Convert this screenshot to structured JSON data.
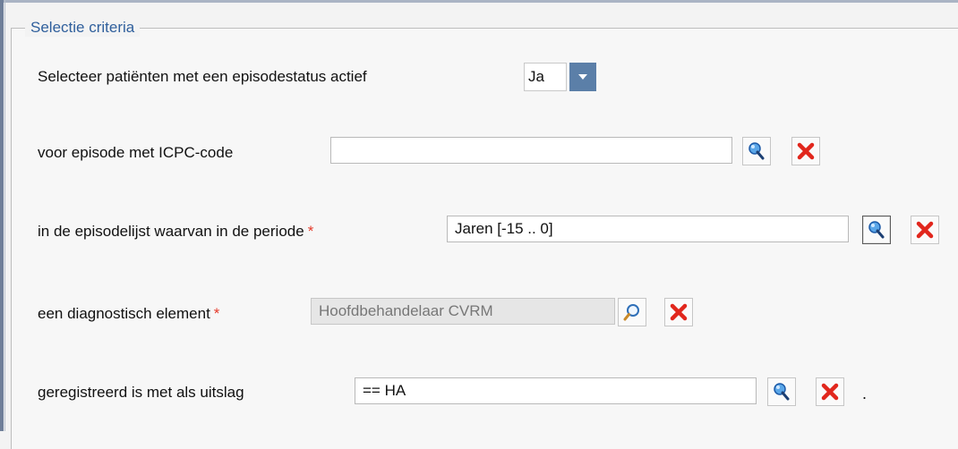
{
  "panel": {
    "legend": "Selectie criteria"
  },
  "rows": {
    "status": {
      "label": "Selecteer patiënten met een episodestatus actief",
      "value": "Ja"
    },
    "icpc": {
      "label": "voor episode met ICPC-code",
      "value": ""
    },
    "period": {
      "label": "in de episodelijst waarvan in de periode",
      "required_mark": "*",
      "value": "Jaren [-15 .. 0]"
    },
    "diagnostic": {
      "label": "een diagnostisch element",
      "required_mark": "*",
      "value": "Hoofdbehandelaar CVRM"
    },
    "result": {
      "label": "geregistreerd is met als uitslag",
      "value": "== HA",
      "trailing": "."
    }
  },
  "colors": {
    "legend": "#2f5f9c",
    "required": "#e53b2b",
    "clear_icon": "#e1261c",
    "dropdown": "#5b7fa8"
  },
  "icons": {
    "lookup": "pin-search-icon",
    "search": "magnifier-icon",
    "clear": "red-x-icon",
    "dropdown": "chevron-down-icon"
  }
}
